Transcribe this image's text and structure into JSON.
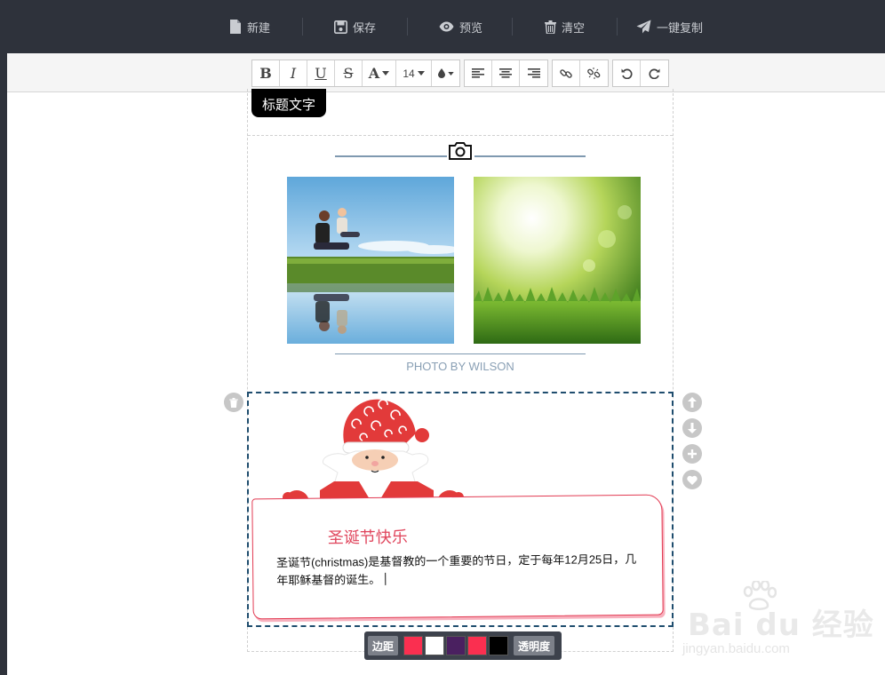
{
  "topbar": {
    "new_label": "新建",
    "save_label": "保存",
    "preview_label": "预览",
    "clear_label": "清空",
    "copy_label": "一键复制"
  },
  "toolbar": {
    "bold": "B",
    "italic": "I",
    "underline": "U",
    "strike": "S",
    "font_color": "A",
    "font_size": "14"
  },
  "editor": {
    "title_pill": "标题文字",
    "photo_caption": "PHOTO BY WILSON",
    "card_title": "圣诞节快乐",
    "card_body": "圣诞节(christmas)是基督教的一个重要的节日，定于每年12月25日，几年耶稣基督的诞生。"
  },
  "palette": {
    "margin_label": "边距",
    "opacity_label": "透明度",
    "swatches": [
      "#fa2f50",
      "#ffffff",
      "#4a2060",
      "#fa2f50",
      "#000000"
    ]
  },
  "watermark": {
    "main": "Bai du 经验",
    "sub": "jingyan.baidu.com"
  },
  "colors": {
    "topbar_bg": "#2e323b",
    "accent_red": "#e23a52",
    "block_border": "#1f4d6e"
  }
}
